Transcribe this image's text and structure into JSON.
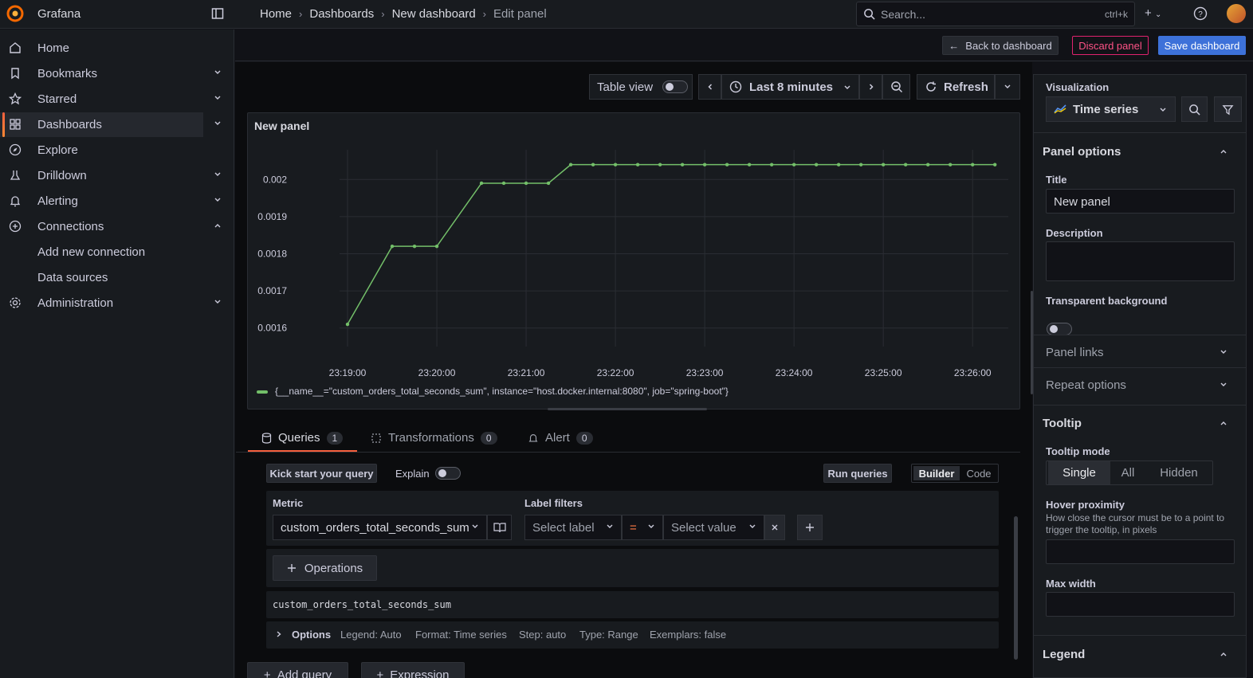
{
  "app": {
    "name": "Grafana"
  },
  "breadcrumbs": [
    "Home",
    "Dashboards",
    "New dashboard",
    "Edit panel"
  ],
  "search": {
    "placeholder": "Search...",
    "shortcut": "ctrl+k"
  },
  "sidebar": {
    "items": [
      {
        "label": "Home",
        "icon": "home-icon"
      },
      {
        "label": "Bookmarks",
        "icon": "bookmark-icon"
      },
      {
        "label": "Starred",
        "icon": "star-icon"
      },
      {
        "label": "Dashboards",
        "icon": "dashboards-icon"
      },
      {
        "label": "Explore",
        "icon": "compass-icon"
      },
      {
        "label": "Drilldown",
        "icon": "drilldown-icon"
      },
      {
        "label": "Alerting",
        "icon": "bell-icon"
      },
      {
        "label": "Connections",
        "icon": "connections-icon"
      },
      {
        "label": "Add new connection"
      },
      {
        "label": "Data sources"
      },
      {
        "label": "Administration",
        "icon": "gear-icon"
      }
    ]
  },
  "actions": {
    "back": "Back to dashboard",
    "discard": "Discard panel",
    "save": "Save dashboard"
  },
  "toolbar": {
    "table_view": "Table view",
    "time_range": "Last 8 minutes",
    "refresh": "Refresh"
  },
  "panel": {
    "title": "New panel",
    "legend": "{__name__=\"custom_orders_total_seconds_sum\", instance=\"host.docker.internal:8080\", job=\"spring-boot\"}"
  },
  "chart_data": {
    "type": "line",
    "x_ticks": [
      "23:19:00",
      "23:20:00",
      "23:21:00",
      "23:22:00",
      "23:23:00",
      "23:24:00",
      "23:25:00",
      "23:26:00"
    ],
    "y_ticks": [
      "0.002",
      "0.0019",
      "0.0018",
      "0.0017",
      "0.0016"
    ],
    "ylim": [
      0.00155,
      0.00208
    ],
    "x_minutes": [
      0,
      0.5,
      0.75,
      1.0,
      1.5,
      1.75,
      2.0,
      2.25,
      2.5,
      2.75,
      3.0,
      3.25,
      3.5,
      3.75,
      4.0,
      4.25,
      4.5,
      4.75,
      5.0,
      5.25,
      5.5,
      5.75,
      6.0,
      6.25,
      6.5,
      6.75,
      7.0,
      7.25
    ],
    "series": [
      {
        "name": "{__name__=\"custom_orders_total_seconds_sum\", instance=\"host.docker.internal:8080\", job=\"spring-boot\"}",
        "color": "#73bf69",
        "values": [
          0.00161,
          0.00182,
          0.00182,
          0.00182,
          0.00199,
          0.00199,
          0.00199,
          0.00199,
          0.00204,
          0.00204,
          0.00204,
          0.00204,
          0.00204,
          0.00204,
          0.00204,
          0.00204,
          0.00204,
          0.00204,
          0.00204,
          0.00204,
          0.00204,
          0.00204,
          0.00204,
          0.00204,
          0.00204,
          0.00204,
          0.00204,
          0.00204
        ]
      }
    ],
    "grid": true,
    "legend": "bottom"
  },
  "query_tabs": [
    {
      "label": "Queries",
      "count": "1"
    },
    {
      "label": "Transformations",
      "count": "0"
    },
    {
      "label": "Alert",
      "count": "0"
    }
  ],
  "query": {
    "kick_start": "Kick start your query",
    "explain": "Explain",
    "run": "Run queries",
    "builder": "Builder",
    "code": "Code",
    "metric_label": "Metric",
    "metric_value": "custom_orders_total_seconds_sum",
    "label_filters": "Label filters",
    "select_label": "Select label",
    "operator": "=",
    "select_value": "Select value",
    "operations": "Operations",
    "expr": "custom_orders_total_seconds_sum",
    "options_label": "Options",
    "options": [
      "Legend: Auto",
      "Format: Time series",
      "Step: auto",
      "Type: Range",
      "Exemplars: false"
    ],
    "add_query": "Add query",
    "expression": "Expression"
  },
  "options_pane": {
    "visualization_label": "Visualization",
    "visualization": "Time series",
    "panel_options": "Panel options",
    "title_label": "Title",
    "title_value": "New panel",
    "description_label": "Description",
    "transparent_label": "Transparent background",
    "panel_links": "Panel links",
    "repeat_options": "Repeat options",
    "tooltip": "Tooltip",
    "tooltip_mode": "Tooltip mode",
    "modes": [
      "Single",
      "All",
      "Hidden"
    ],
    "hover_label": "Hover proximity",
    "hover_desc": "How close the cursor must be to a point to trigger the tooltip, in pixels",
    "max_width": "Max width",
    "legend": "Legend"
  }
}
